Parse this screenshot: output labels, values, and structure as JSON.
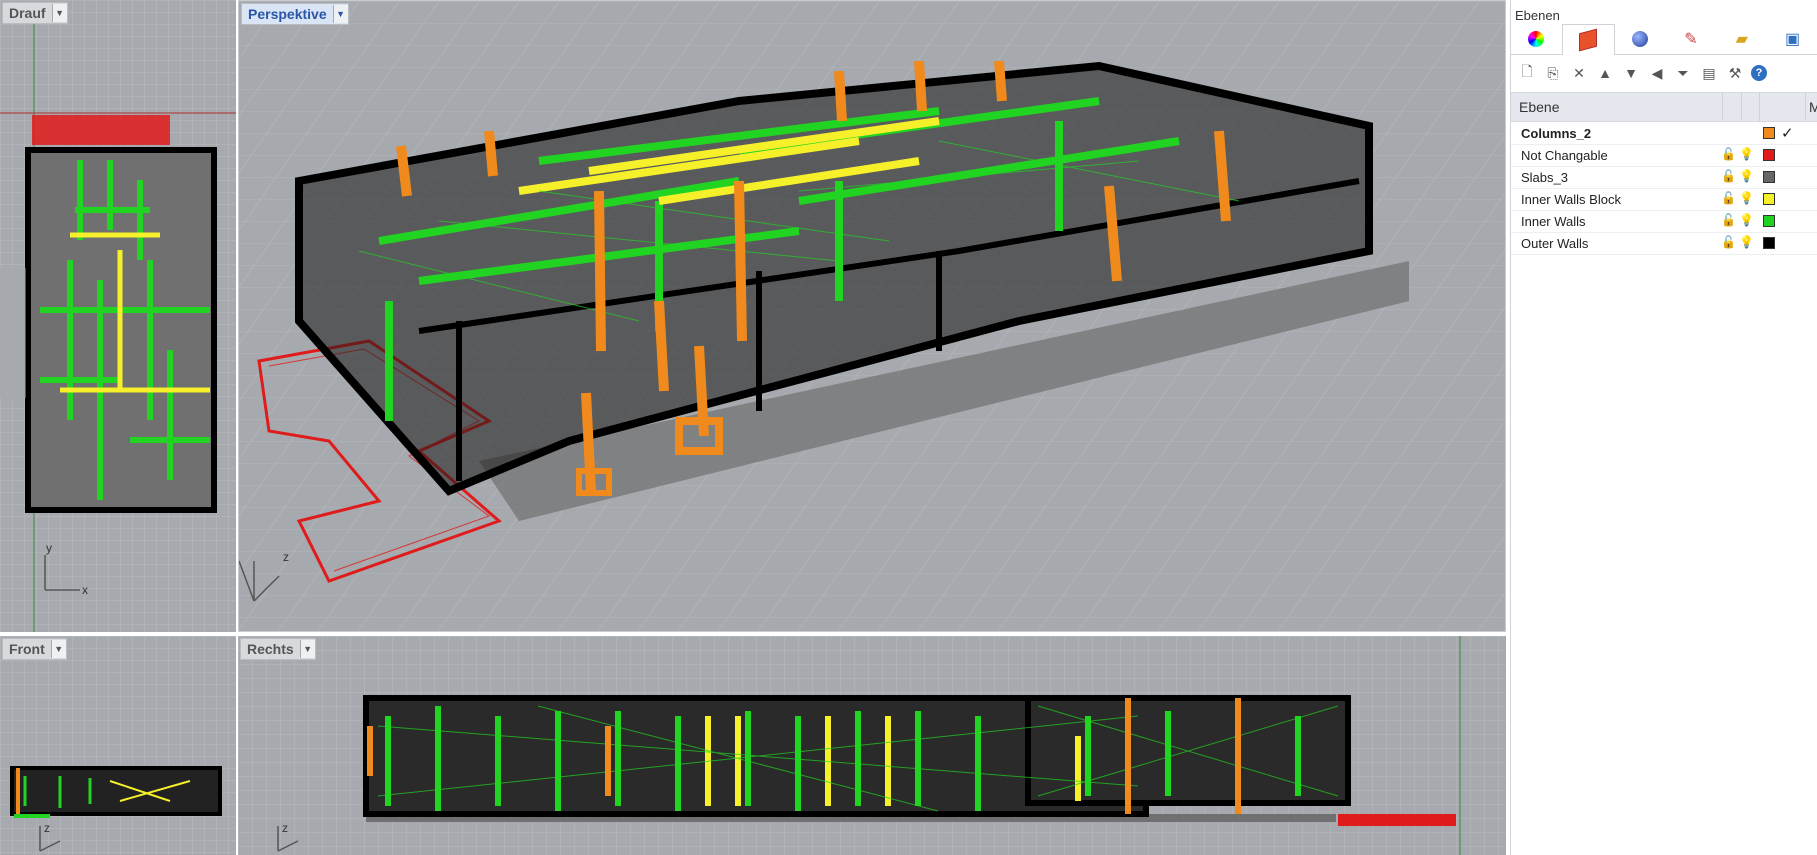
{
  "viewports": {
    "top": {
      "label": "Drauf",
      "axis_y": "y",
      "axis_x": "x"
    },
    "perspective": {
      "label": "Perspektive",
      "axis_z": "z"
    },
    "front": {
      "label": "Front",
      "axis_z": "z"
    },
    "right": {
      "label": "Rechts",
      "axis_z": "z"
    }
  },
  "layers_panel": {
    "title": "Ebenen",
    "tabs": [
      {
        "icon": "color-wheel-icon"
      },
      {
        "icon": "layers-icon"
      },
      {
        "icon": "render-sphere-icon"
      },
      {
        "icon": "brush-icon"
      },
      {
        "icon": "folder-icon"
      },
      {
        "icon": "camera-icon"
      }
    ],
    "toolbar": [
      {
        "icon": "new-layer-icon",
        "glyph": "🗋"
      },
      {
        "icon": "new-sublayer-icon",
        "glyph": "⎘"
      },
      {
        "icon": "delete-icon",
        "glyph": "✕"
      },
      {
        "icon": "move-up-icon",
        "glyph": "▲"
      },
      {
        "icon": "move-down-icon",
        "glyph": "▼"
      },
      {
        "icon": "move-out-icon",
        "glyph": "◀"
      },
      {
        "icon": "filter-icon",
        "glyph": "⏷"
      },
      {
        "icon": "properties-icon",
        "glyph": "▤"
      },
      {
        "icon": "tools-icon",
        "glyph": "⚒"
      },
      {
        "icon": "help-icon",
        "glyph": "?"
      }
    ],
    "column_header": "Ebene",
    "column_header_right": "M",
    "layers": [
      {
        "name": "Columns_2",
        "color": "#f08a1c",
        "current": true,
        "check": "✓"
      },
      {
        "name": "Not Changable",
        "color": "#e01b1b",
        "current": false
      },
      {
        "name": "Slabs_3",
        "color": "#666666",
        "current": false
      },
      {
        "name": "Inner Walls Block",
        "color": "#f5f02a",
        "current": false
      },
      {
        "name": "Inner Walls",
        "color": "#21d421",
        "current": false
      },
      {
        "name": "Outer Walls",
        "color": "#000000",
        "current": false
      }
    ]
  },
  "colors": {
    "columns": "#f08a1c",
    "not_changable": "#e01b1b",
    "slabs": "#666666",
    "inner_walls_block": "#f5f02a",
    "inner_walls": "#21d421",
    "outer_walls": "#000000",
    "viewport_bg": "#a6a9ad",
    "grid_line": "#b8bbbf"
  }
}
